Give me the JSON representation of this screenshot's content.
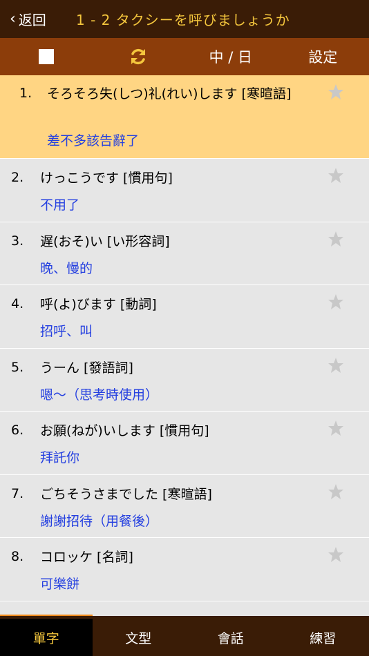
{
  "header": {
    "back_label": "返回",
    "title": "1 - 2 タクシーを呼びましょうか"
  },
  "toolbar": {
    "lang_label": "中 / 日",
    "settings_label": "設定"
  },
  "items": [
    {
      "num": "1.",
      "jp": "そろそろ失(しつ)礼(れい)します  [寒暄語]",
      "zh": "差不多該告辭了"
    },
    {
      "num": "2.",
      "jp": "けっこうです  [慣用句]",
      "zh": "不用了"
    },
    {
      "num": "3.",
      "jp": "遅(おそ)い  [い形容詞]",
      "zh": "晚、慢的"
    },
    {
      "num": "4.",
      "jp": "呼(よ)びます  [動詞]",
      "zh": "招呼、叫"
    },
    {
      "num": "5.",
      "jp": "うーん  [發語詞]",
      "zh": "嗯～（思考時使用）"
    },
    {
      "num": "6.",
      "jp": "お願(ねが)いします  [慣用句]",
      "zh": "拜託你"
    },
    {
      "num": "7.",
      "jp": "ごちそうさまでした  [寒暄語]",
      "zh": "謝謝招待（用餐後）"
    },
    {
      "num": "8.",
      "jp": "コロッケ  [名詞]",
      "zh": "可樂餅"
    }
  ],
  "tabs": [
    {
      "label": "單字"
    },
    {
      "label": "文型"
    },
    {
      "label": "會話"
    },
    {
      "label": "練習"
    }
  ],
  "colors": {
    "header_bg": "#3a1c06",
    "toolbar_bg": "#8c3d0a",
    "accent": "#f4c63d",
    "selected_row": "#ffd583",
    "translation": "#2540e0",
    "tab_indicator": "#f08a1a"
  }
}
